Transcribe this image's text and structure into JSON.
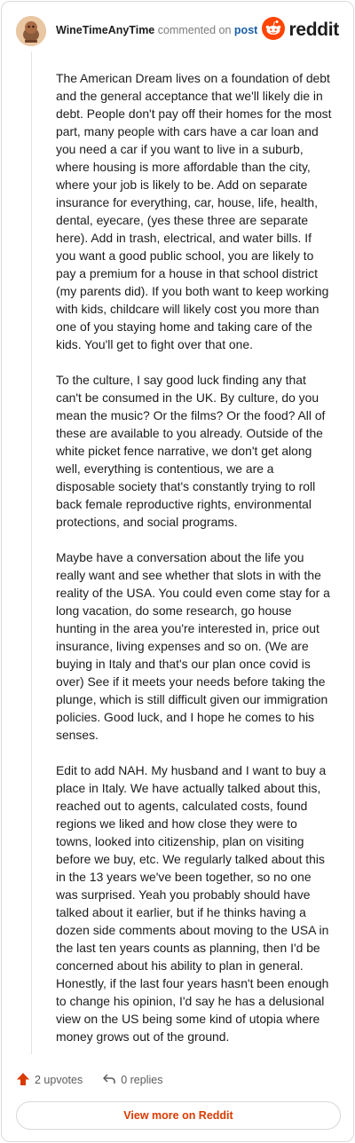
{
  "header": {
    "username": "WineTimeAnyTime",
    "action_text": "commented on",
    "link_text": "post",
    "logo_text": "reddit",
    "avatar_icon": "snoo-avatar-icon",
    "logo_icon": "reddit-logo-icon"
  },
  "comment": {
    "paragraphs": [
      "The American Dream lives on a foundation of debt and the general acceptance that we'll likely die in debt. People don't pay off their homes for the most part, many people with cars have a car loan and you need a car if you want to live in a suburb, where housing is more affordable than the city, where your job is likely to be. Add on separate insurance for everything, car, house, life, health, dental, eyecare, (yes these three are separate here). Add in trash, electrical, and water bills. If you want a good public school, you are likely to pay a premium for a house in that school district (my parents did). If you both want to keep working with kids, childcare will likely cost you more than one of you staying home and taking care of the kids. You'll get to fight over that one.",
      "To the culture, I say good luck finding any that can't be consumed in the UK. By culture, do you mean the music? Or the films? Or the food? All of these are available to you already. Outside of the white picket fence narrative, we don't get along well, everything is contentious, we are a disposable society that's constantly trying to roll back female reproductive rights, environmental protections, and social programs.",
      "Maybe have a conversation about the life you really want and see whether that slots in with the reality of the USA. You could even come stay for a long vacation, do some research, go house hunting in the area you're interested in, price out insurance, living expenses and so on. (We are buying in Italy and that's our plan once covid is over) See if it meets your needs before taking the plunge, which is still difficult given our immigration policies. Good luck, and I hope he comes to his senses.",
      "Edit to add NAH. My husband and I want to buy a place in Italy. We have actually talked about this, reached out to agents, calculated costs, found regions we liked and how close they were to towns, looked into citizenship, plan on visiting before we buy, etc. We regularly talked about this in the 13 years we've been together, so no one was surprised. Yeah you probably should have talked about it earlier, but if he thinks having a dozen side comments about moving to the USA in the last ten years counts as planning, then I'd be concerned about his ability to plan in general. Honestly, if the last four years hasn't been enough to change his opinion, I'd say he has a delusional view on the US being some kind of utopia where money grows out of the ground."
    ]
  },
  "footer": {
    "upvotes": "2 upvotes",
    "replies": "0 replies",
    "upvote_icon": "upvote-arrow-icon",
    "reply_icon": "reply-arrow-icon",
    "view_more": "View more on Reddit"
  },
  "colors": {
    "accent": "#d93a00",
    "link": "#1a5fa8",
    "text": "#1c1c1c",
    "muted": "#7c7c7c",
    "border": "#dcdcdc"
  }
}
